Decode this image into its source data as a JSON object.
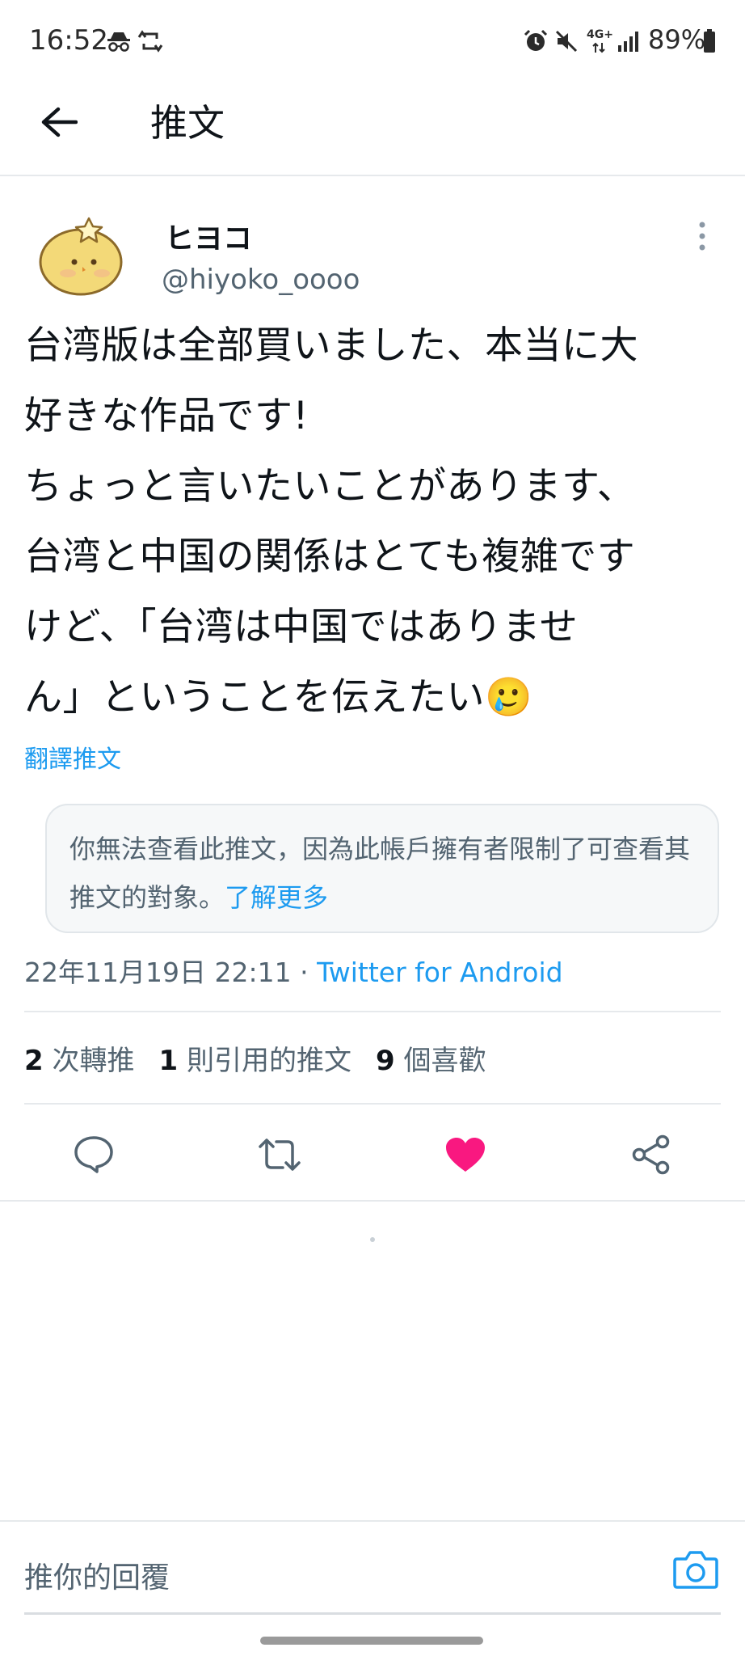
{
  "status_bar": {
    "time": "16:52",
    "network": "4G+",
    "battery": "89%"
  },
  "header": {
    "back_icon": "arrow-left-icon",
    "title": "推文"
  },
  "tweet": {
    "display_name": "ヒヨコ",
    "handle": "@hiyoko_oooo",
    "text": "台湾版は全部買いました、本当に大\n好きな作品です!\nちょっと言いたいことがあります、\n台湾と中国の関係はとても複雑です\nけど、「台湾は中国ではありませ\nん」ということを伝えたい🥲",
    "translate_label": "翻譯推文",
    "restricted_notice": "你無法查看此推文，因為此帳戶擁有者限制了可查看其推文的對象。",
    "restricted_link": "了解更多",
    "timestamp": "22年11月19日 22:11",
    "separator": " · ",
    "source": "Twitter for Android",
    "stats": {
      "retweets_count": "2",
      "retweets_label": "次轉推",
      "quotes_count": "1",
      "quotes_label": "則引用的推文",
      "likes_count": "9",
      "likes_label": "個喜歡"
    },
    "actions": [
      "reply-icon",
      "retweet-icon",
      "heart-icon",
      "share-icon"
    ]
  },
  "reply": {
    "placeholder": "推你的回覆"
  },
  "colors": {
    "accent": "#1d9bf0",
    "like": "#f91880",
    "text_secondary": "#536471"
  }
}
